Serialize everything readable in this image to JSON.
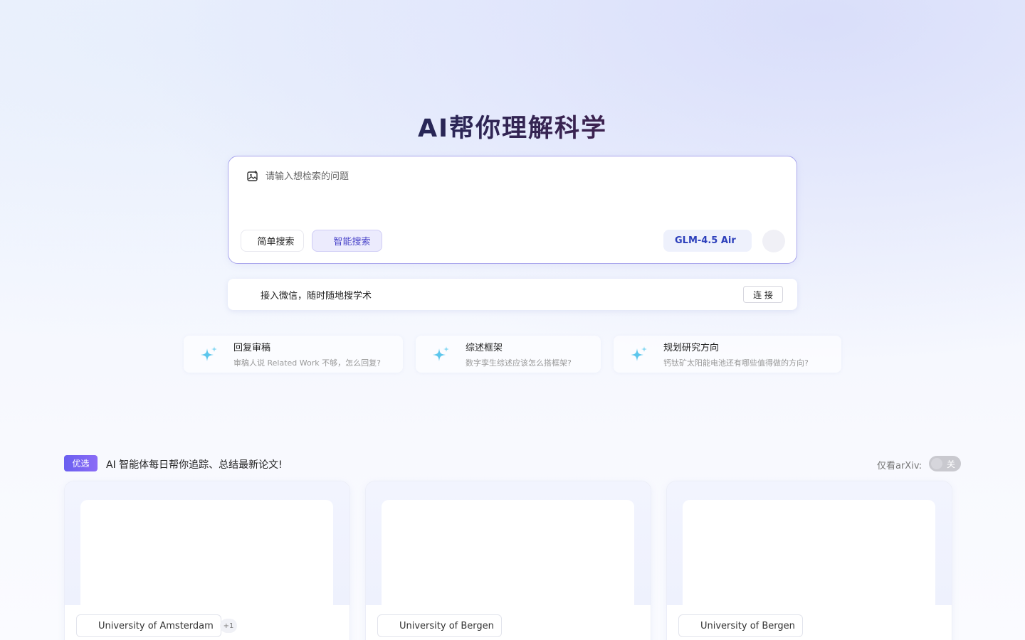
{
  "hero": {
    "title": "AI帮你理解科学"
  },
  "search": {
    "placeholder": "请输入想检索的问题",
    "modes": [
      {
        "label": "简单搜索",
        "active": false
      },
      {
        "label": "智能搜索",
        "active": true
      }
    ],
    "model": "GLM-4.5 Air"
  },
  "wechat": {
    "text": "接入微信，随时随地搜学术",
    "button": "连 接"
  },
  "suggestions": [
    {
      "title": "回复审稿",
      "subtitle": "审稿人说 Related Work 不够，怎么回复?"
    },
    {
      "title": "综述框架",
      "subtitle": "数字孪生综述应该怎么搭框架?"
    },
    {
      "title": "规划研究方向",
      "subtitle": "钙钛矿太阳能电池还有哪些值得做的方向?"
    }
  ],
  "feed": {
    "badge": "优选",
    "title": "AI 智能体每日帮你追踪、总结最新论文!",
    "arxiv_label": "仅看arXiv:",
    "arxiv_toggle": "关"
  },
  "cards": [
    {
      "institution": "University of Amsterdam",
      "more": "+1"
    },
    {
      "institution": "University of Bergen"
    },
    {
      "institution": "University of Bergen"
    }
  ],
  "colors": {
    "accent": "#4a44c9",
    "title_start": "#1a2a5c",
    "title_end": "#4a1f4a",
    "border": "#a9a6ec"
  }
}
